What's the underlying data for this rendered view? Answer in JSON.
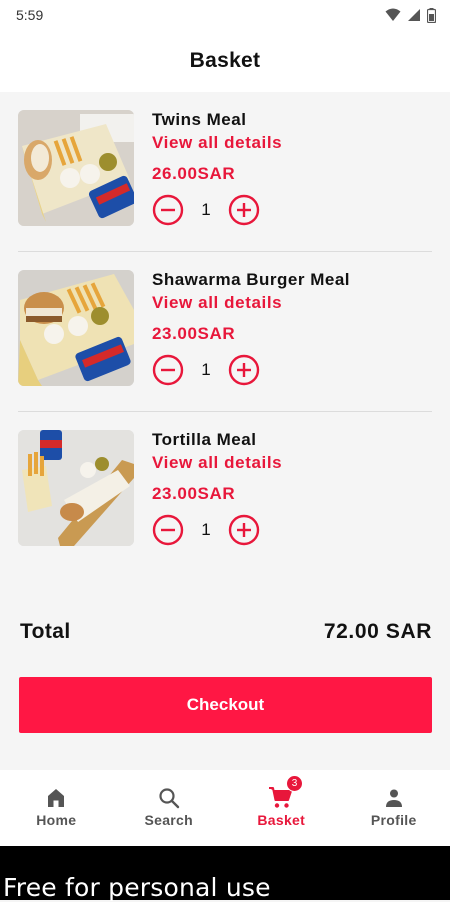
{
  "status_bar": {
    "time": "5:59"
  },
  "header": {
    "title": "Basket"
  },
  "items": [
    {
      "name": "Twins Meal",
      "details_label": "View all details",
      "price": "26.00SAR",
      "quantity": "1"
    },
    {
      "name": "Shawarma Burger Meal",
      "details_label": "View all details",
      "price": "23.00SAR",
      "quantity": "1"
    },
    {
      "name": "Tortilla Meal",
      "details_label": "View all details",
      "price": "23.00SAR",
      "quantity": "1"
    }
  ],
  "summary": {
    "total_label": "Total",
    "total_value": "72.00 SAR"
  },
  "checkout": {
    "label": "Checkout"
  },
  "bottom_nav": {
    "items": [
      {
        "label": "Home",
        "icon": "home-icon"
      },
      {
        "label": "Search",
        "icon": "search-icon"
      },
      {
        "label": "Basket",
        "icon": "cart-icon",
        "badge": "3",
        "active": true
      },
      {
        "label": "Profile",
        "icon": "person-icon"
      }
    ]
  },
  "watermark": {
    "text": "Free for personal use"
  },
  "colors": {
    "accent": "#e8173b",
    "button": "#ff1744",
    "background": "#f5f5f5"
  }
}
